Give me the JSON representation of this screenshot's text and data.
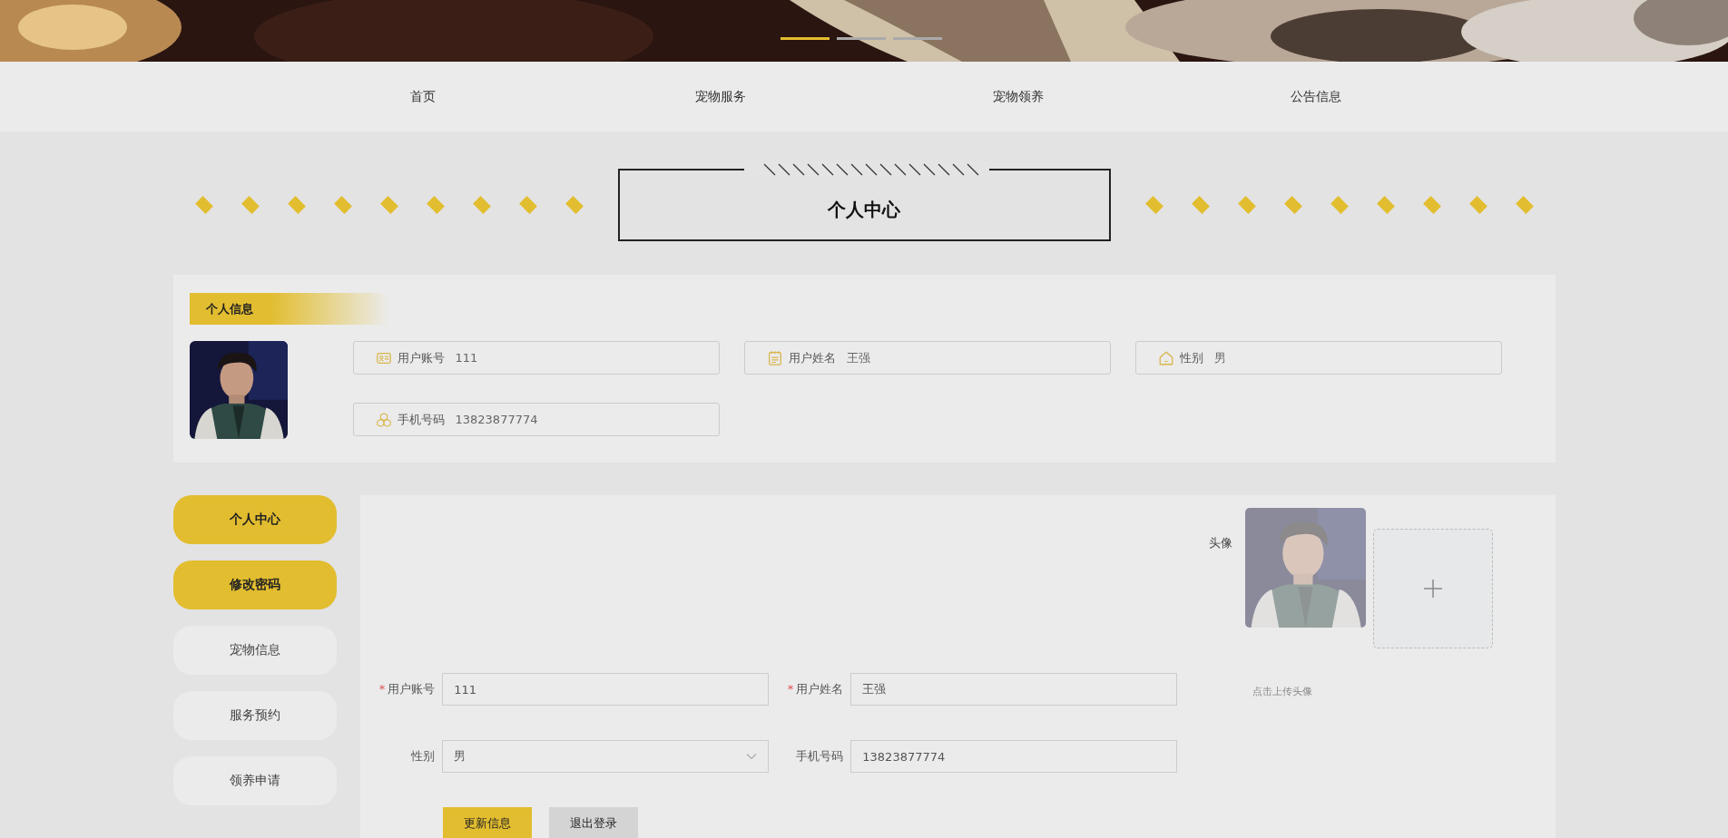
{
  "banner": {
    "kind": "picture",
    "slides": [
      {
        "selected": true
      },
      {
        "selected": false
      },
      {
        "selected": false
      }
    ]
  },
  "nav": [
    {
      "label": "首页"
    },
    {
      "label": "宠物服务"
    },
    {
      "label": "宠物领养"
    },
    {
      "label": "公告信息"
    }
  ],
  "page_title": "个人中心",
  "info": {
    "heading": "个人信息",
    "fields": [
      {
        "kind": "account",
        "label": "用户账号",
        "value": "111"
      },
      {
        "kind": "name",
        "label": "用户姓名",
        "value": "王强"
      },
      {
        "kind": "gender",
        "label": "性别",
        "value": "男"
      },
      {
        "kind": "phone",
        "label": "手机号码",
        "value": "13823877774"
      }
    ]
  },
  "sidebar": [
    {
      "label": "个人中心",
      "selected": true
    },
    {
      "label": "修改密码",
      "selected": true
    },
    {
      "label": "宠物信息",
      "selected": false
    },
    {
      "label": "服务预约",
      "selected": false
    },
    {
      "label": "领养申请",
      "selected": false
    }
  ],
  "form": {
    "avatar_label": "头像",
    "upload_hint": "点击上传头像",
    "fields": [
      {
        "kind": "text",
        "mark": "*",
        "label": "用户账号",
        "value": "111"
      },
      {
        "kind": "text",
        "mark": "*",
        "label": "用户姓名",
        "value": "王强"
      },
      {
        "kind": "select",
        "label": "性别",
        "value": "男"
      },
      {
        "kind": "text",
        "label": "手机号码",
        "value": "13823877774"
      }
    ],
    "buttons": [
      {
        "kind": "primary",
        "label": "更新信息"
      },
      {
        "kind": "secondary",
        "label": "退出登录"
      }
    ]
  }
}
